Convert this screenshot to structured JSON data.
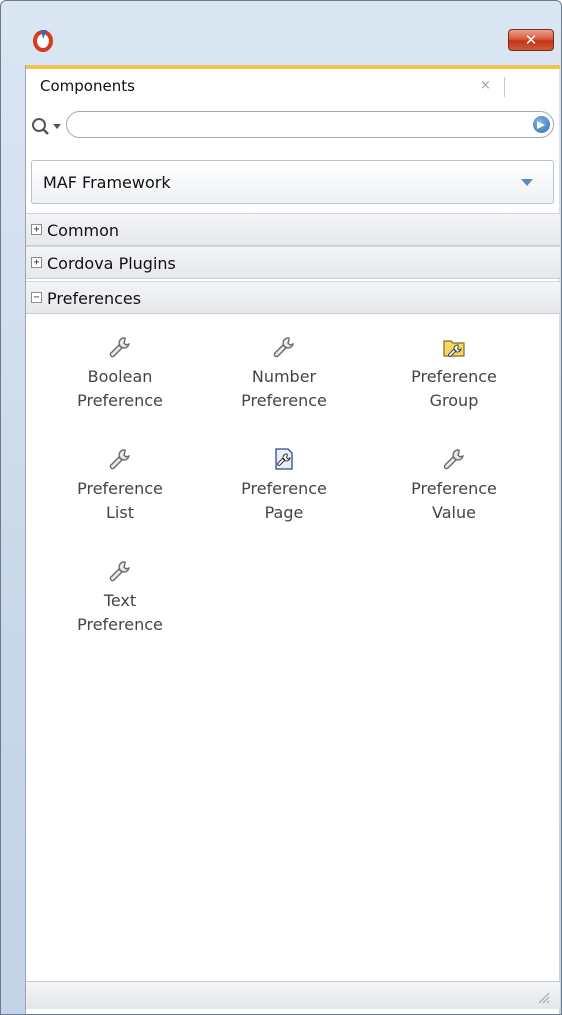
{
  "window": {
    "close_glyph": "✕"
  },
  "panel": {
    "tab_label": "Components",
    "tab_close": "×"
  },
  "search": {
    "value": "",
    "placeholder": ""
  },
  "library_select": {
    "value": "MAF Framework"
  },
  "sections": [
    {
      "label": "Common",
      "expanded": false,
      "toggle": "+"
    },
    {
      "label": "Cordova Plugins",
      "expanded": false,
      "toggle": "+"
    },
    {
      "label": "Preferences",
      "expanded": true,
      "toggle": "−"
    }
  ],
  "components": [
    {
      "line1": "Boolean",
      "line2": "Preference",
      "icon": "wrench-icon"
    },
    {
      "line1": "Number",
      "line2": "Preference",
      "icon": "wrench-icon"
    },
    {
      "line1": "Preference",
      "line2": "Group",
      "icon": "folder-wrench-icon"
    },
    {
      "line1": "Preference",
      "line2": "List",
      "icon": "wrench-icon"
    },
    {
      "line1": "Preference",
      "line2": "Page",
      "icon": "page-wrench-icon"
    },
    {
      "line1": "Preference",
      "line2": "Value",
      "icon": "wrench-icon"
    },
    {
      "line1": "Text",
      "line2": "Preference",
      "icon": "wrench-icon"
    }
  ],
  "colors": {
    "accent": "#f1c24e",
    "close_button": "#c43318",
    "title_bar": "#c9d8ea"
  }
}
